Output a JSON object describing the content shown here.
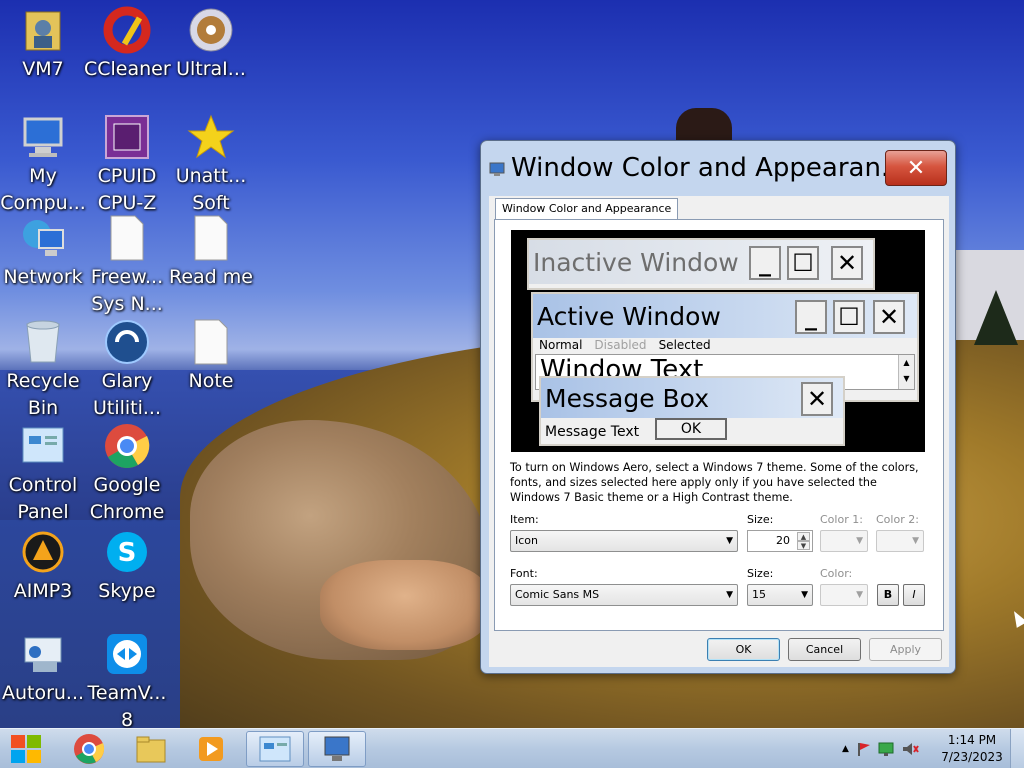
{
  "desktop_icons": [
    {
      "label": "VM7",
      "icon": "user-folder-icon"
    },
    {
      "label": "CCleaner",
      "icon": "ccleaner-icon"
    },
    {
      "label": "UltraI...",
      "icon": "disc-icon"
    },
    {
      "label": "My\nCompu...",
      "icon": "computer-icon"
    },
    {
      "label": "CPUID\nCPU-Z",
      "icon": "cpuz-icon"
    },
    {
      "label": "Unatt...\nSoft",
      "icon": "star-icon"
    },
    {
      "label": "Network",
      "icon": "network-icon"
    },
    {
      "label": "Freew...\nSys N...",
      "icon": "document-icon"
    },
    {
      "label": "Read me",
      "icon": "document-icon"
    },
    {
      "label": "Recycle\nBin",
      "icon": "recycle-bin-icon"
    },
    {
      "label": "Glary\nUtiliti...",
      "icon": "glary-icon"
    },
    {
      "label": "Note",
      "icon": "document-icon"
    },
    {
      "label": "Control\nPanel",
      "icon": "control-panel-icon"
    },
    {
      "label": "Google\nChrome",
      "icon": "chrome-icon"
    },
    {
      "label": "AIMP3",
      "icon": "aimp-icon"
    },
    {
      "label": "Skype",
      "icon": "skype-icon"
    },
    {
      "label": "Autoru...",
      "icon": "autoruns-icon"
    },
    {
      "label": "TeamV...\n8",
      "icon": "teamviewer-icon"
    }
  ],
  "dialog": {
    "title": "Window Color and Appearan...",
    "close_label": "✕",
    "tab_label": "Window Color and Appearance",
    "preview": {
      "inactive_title": "Inactive Window",
      "active_title": "Active Window",
      "menu_normal": "Normal",
      "menu_disabled": "Disabled",
      "menu_selected": "Selected",
      "window_text": "Window Text",
      "message_box_title": "Message Box",
      "message_text": "Message Text",
      "ok_label": "OK",
      "btn_min": "_",
      "btn_max": "☐",
      "btn_close": "✕"
    },
    "description": "To turn on Windows Aero, select a Windows 7 theme.  Some of the colors, fonts, and sizes selected here apply only if you have selected the Windows 7 Basic theme or a High Contrast theme.",
    "item_label": "Item:",
    "item_value": "Icon",
    "size_label": "Size:",
    "size_value": "20",
    "color1_label": "Color 1:",
    "color2_label": "Color 2:",
    "font_label": "Font:",
    "font_value": "Comic Sans MS",
    "font_size_label": "Size:",
    "font_size_value": "15",
    "font_color_label": "Color:",
    "bold_label": "B",
    "italic_label": "I",
    "ok_button": "OK",
    "cancel_button": "Cancel",
    "apply_button": "Apply"
  },
  "taskbar": {
    "clock_time": "1:14 PM",
    "clock_date": "7/23/2023",
    "items": [
      "start",
      "chrome",
      "explorer",
      "media-player",
      "control-panel",
      "display-properties"
    ]
  },
  "colors": {
    "taskbar": "#b6c9e1",
    "dialog_frame": "#c4d6ee",
    "close_button": "#d6553f",
    "preview_title_bar": "#b9cdec"
  }
}
